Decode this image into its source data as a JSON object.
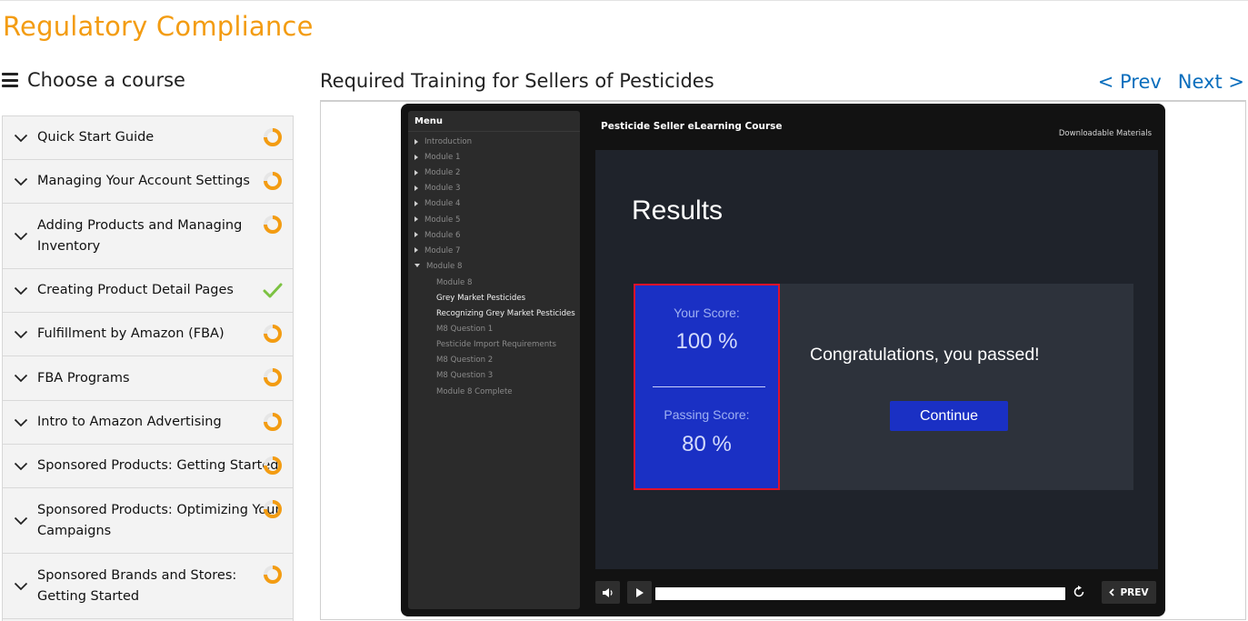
{
  "page": {
    "title": "Regulatory Compliance",
    "title_color": "#f39c12",
    "link_color": "#0b6ebd"
  },
  "sidebar": {
    "heading": "Choose a course",
    "heading_icon": "hamburger-menu-icon",
    "items": [
      {
        "label": "Quick Start Guide",
        "status": "in-progress"
      },
      {
        "label": "Managing Your Account Settings",
        "status": "in-progress"
      },
      {
        "label": "Adding Products and Managing Inventory",
        "status": "in-progress"
      },
      {
        "label": "Creating Product Detail Pages",
        "status": "complete"
      },
      {
        "label": "Fulfillment by Amazon (FBA)",
        "status": "in-progress"
      },
      {
        "label": "FBA Programs",
        "status": "in-progress"
      },
      {
        "label": "Intro to Amazon Advertising",
        "status": "in-progress"
      },
      {
        "label": "Sponsored Products: Getting Started",
        "status": "in-progress"
      },
      {
        "label": "Sponsored Products: Optimizing Your Campaigns",
        "status": "in-progress"
      },
      {
        "label": "Sponsored Brands and Stores: Getting Started",
        "status": "in-progress"
      }
    ],
    "status_colors": {
      "in-progress": "#f39c12",
      "complete": "#7cc242"
    }
  },
  "main": {
    "title": "Required Training for Sellers of Pesticides",
    "prev_label": "< Prev",
    "next_label": "Next >"
  },
  "player": {
    "menu_title": "Menu",
    "course_title": "Pesticide Seller eLearning Course",
    "downloads_label": "Downloadable Materials",
    "menu_items": [
      {
        "label": "Introduction",
        "type": "collapsed"
      },
      {
        "label": "Module 1",
        "type": "collapsed"
      },
      {
        "label": "Module 2",
        "type": "collapsed"
      },
      {
        "label": "Module 3",
        "type": "collapsed"
      },
      {
        "label": "Module 4",
        "type": "collapsed"
      },
      {
        "label": "Module 5",
        "type": "collapsed"
      },
      {
        "label": "Module 6",
        "type": "collapsed"
      },
      {
        "label": "Module 7",
        "type": "collapsed"
      },
      {
        "label": "Module 8",
        "type": "expanded"
      },
      {
        "label": "Module 8",
        "type": "child",
        "visited": false
      },
      {
        "label": "Grey Market Pesticides",
        "type": "child",
        "visited": true
      },
      {
        "label": "Recognizing Grey Market Pesticides",
        "type": "child",
        "visited": true
      },
      {
        "label": "M8 Question 1",
        "type": "child",
        "visited": false
      },
      {
        "label": "Pesticide Import Requirements",
        "type": "child",
        "visited": false
      },
      {
        "label": "M8 Question 2",
        "type": "child",
        "visited": false
      },
      {
        "label": "M8 Question 3",
        "type": "child",
        "visited": false
      },
      {
        "label": "Module 8 Complete",
        "type": "child",
        "visited": false
      }
    ],
    "slide": {
      "heading": "Results",
      "your_score_label": "Your Score:",
      "your_score_value": "100 %",
      "passing_score_label": "Passing Score:",
      "passing_score_value": "80 %",
      "message": "Congratulations, you passed!",
      "continue_label": "Continue",
      "score_box_color": "#1a30c4",
      "score_box_border": "#e0122b"
    },
    "controls": {
      "volume_icon": "volume-icon",
      "play_icon": "play-icon",
      "replay_icon": "replay-icon",
      "progress_fraction": 1.0,
      "prev_label": "PREV"
    }
  }
}
